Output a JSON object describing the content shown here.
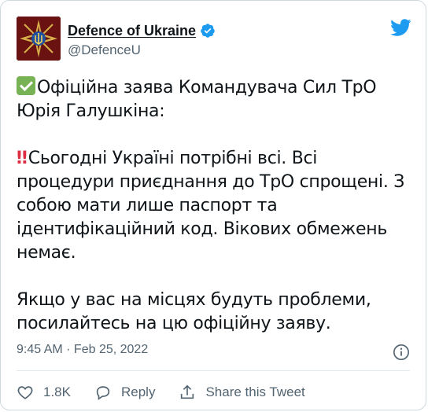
{
  "author": {
    "display_name": "Defence of Ukraine",
    "handle": "@DefenceU",
    "avatar_icon": "ministry-of-defence-emblem",
    "verified_icon": "verified-badge-icon"
  },
  "brand": {
    "icon": "twitter-bird-icon",
    "color": "#1d9bf0"
  },
  "tweet": {
    "line1": "Офіційна заява Командувача Сил ТрО",
    "line2": "Юрія Галушкіна:",
    "p2_line1": "Сьогодні Україні потрібні всі. Всі",
    "p2_line2": "процедури приєднання до ТрО спрощені. З",
    "p2_line3": "собою мати лише паспорт та",
    "p2_line4": "ідентифікаційний код. Вікових обмежень",
    "p2_line5": "немає.",
    "p3_line1": "Якщо у вас на місцях будуть проблеми,",
    "p3_line2": "посилайтесь на цю офіційну заяву.",
    "emoji_check": "check-mark-button-emoji",
    "emoji_bang": "‼"
  },
  "meta": {
    "timestamp": "9:45 AM · Feb 25, 2022",
    "info_icon": "info-icon"
  },
  "actions": {
    "likes": "1.8K",
    "reply_label": "Reply",
    "share_label": "Share this Tweet"
  }
}
